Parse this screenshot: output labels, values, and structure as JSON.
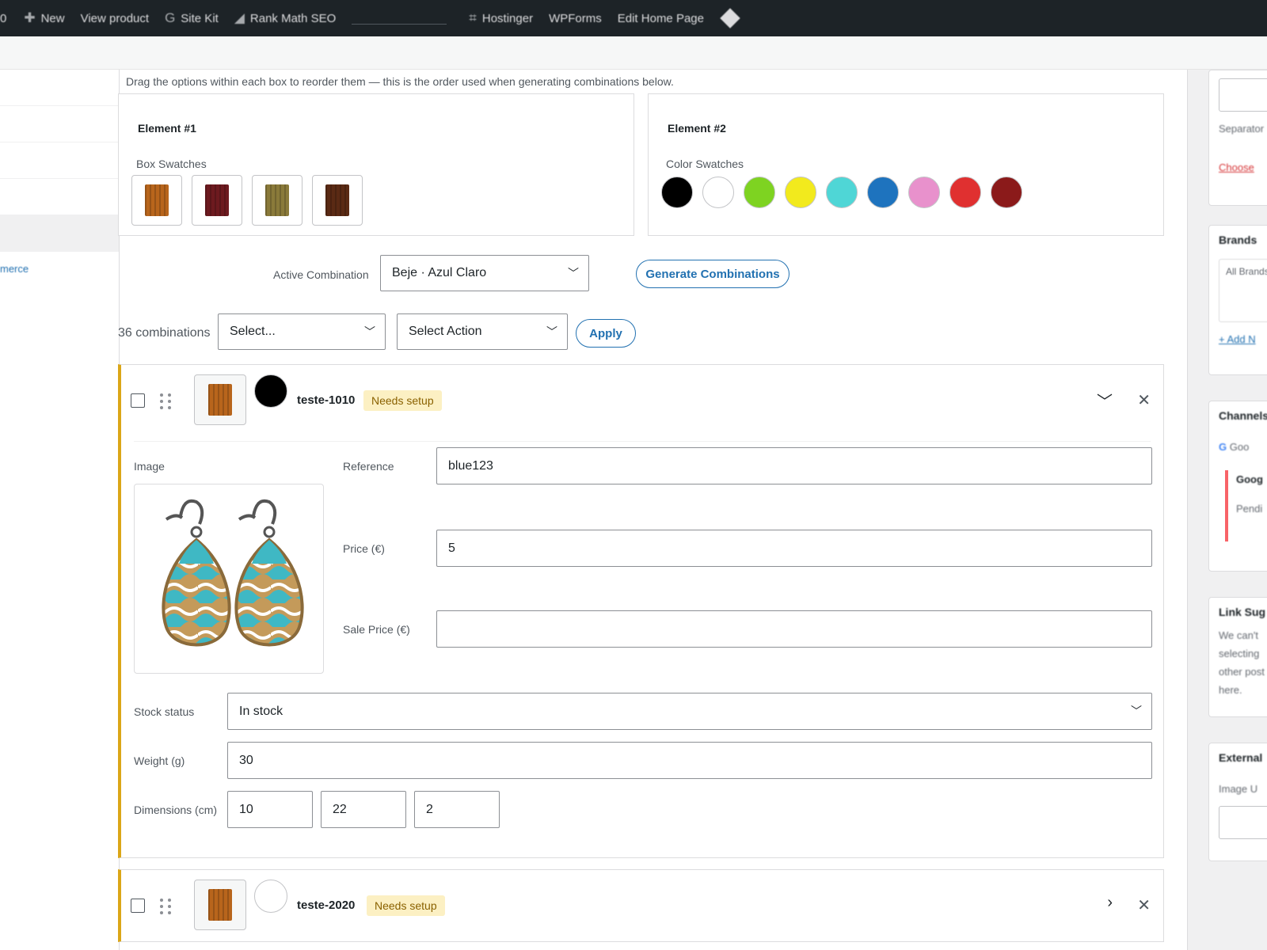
{
  "adminbar": {
    "first": "0",
    "new": "New",
    "view_product": "View product",
    "site_kit": "Site Kit",
    "rank_math": "Rank Math SEO",
    "hostinger": "Hostinger",
    "wpforms": "WPForms",
    "edit_home": "Edit Home Page"
  },
  "leftcol": {
    "link": "merce"
  },
  "main": {
    "hint": "Drag the options within each box to reorder them — this is the order used when generating combinations below.",
    "element1": {
      "name": "Element #1",
      "label": "Box Swatches",
      "swatches": [
        "#b8651c",
        "#6d1a1f",
        "#8a7a3a",
        "#5a2a14"
      ]
    },
    "element2": {
      "name": "Element #2",
      "label": "Color Swatches",
      "colors": [
        "#000000",
        "#ffffff",
        "#7ed321",
        "#f2ea1d",
        "#4fd6d6",
        "#1e73be",
        "#e891cc",
        "#e03030",
        "#8b1a1a"
      ]
    },
    "active_label": "Active Combination",
    "active_value": "Beje · Azul Claro",
    "generate_label": "Generate Combinations",
    "count_text": "36 combinations",
    "select_placeholder": "Select...",
    "select_action": "Select Action",
    "apply_label": "Apply"
  },
  "combination1": {
    "sku": "teste-1010",
    "badge": "Needs setup",
    "swatch": "#b8651c",
    "color": "#000000",
    "image_label": "Image",
    "reference_label": "Reference",
    "reference_value": "blue123",
    "price_label": "Price (€)",
    "price_value": "5",
    "sale_label": "Sale Price (€)",
    "sale_value": "",
    "stock_label": "Stock status",
    "stock_value": "In stock",
    "weight_label": "Weight (g)",
    "weight_value": "30",
    "dims_label": "Dimensions (cm)",
    "dims": [
      "10",
      "22",
      "2"
    ]
  },
  "combination2": {
    "sku": "teste-2020",
    "badge": "Needs setup",
    "swatch": "#b8651c",
    "color": "#ffffff"
  },
  "rightcol": {
    "separator": "Separator",
    "choose": "Choose",
    "brands_title": "Brands",
    "brands_all": "All Brands",
    "brands_add": "+ Add N",
    "channels_title": "Channels",
    "channels_google": "Goo",
    "channels_g2": "Goog",
    "channels_pend": "Pendi",
    "link_title": "Link Sug",
    "link_text1": "We can't",
    "link_text2": "selecting",
    "link_text3": "other post",
    "link_text4": "here.",
    "external_title": "External",
    "external_label": "Image U"
  }
}
